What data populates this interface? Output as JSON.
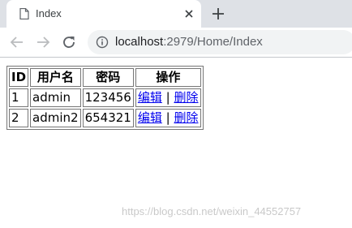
{
  "browser": {
    "tab": {
      "title": "Index"
    },
    "address": {
      "host": "localhost",
      "rest": ":2979/Home/Index"
    }
  },
  "table": {
    "headers": [
      "ID",
      "用户名",
      "密码",
      "操作"
    ],
    "rows": [
      {
        "id": "1",
        "username": "admin",
        "password": "123456",
        "edit": "编辑",
        "sep": "|",
        "delete": "删除"
      },
      {
        "id": "2",
        "username": "admin2",
        "password": "654321",
        "edit": "编辑",
        "sep": "|",
        "delete": "删除"
      }
    ]
  },
  "watermark": "https://blog.csdn.net/weixin_44552757"
}
